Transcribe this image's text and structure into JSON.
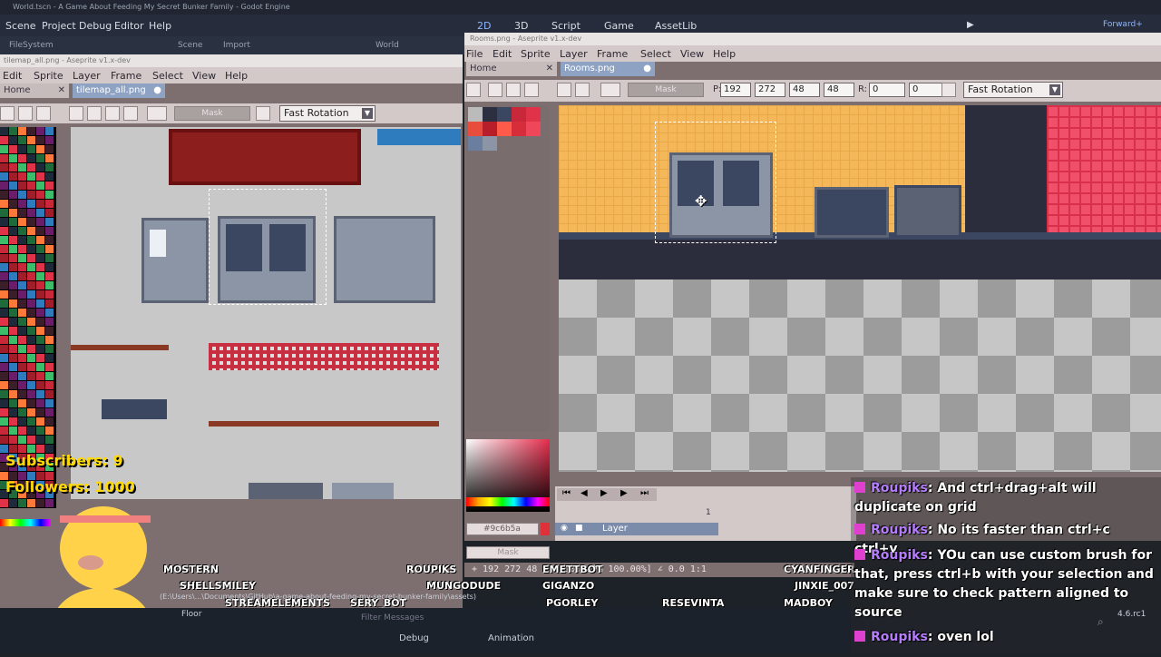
{
  "godot": {
    "window_title": "World.tscn - A Game About Feeding My Secret Bunker Family - Godot Engine",
    "menu": [
      "Scene",
      "Project",
      "Debug",
      "Editor",
      "Help"
    ],
    "workspaces": [
      "2D",
      "3D",
      "Script",
      "Game",
      "AssetLib"
    ],
    "dock_tabs": [
      "FileSystem",
      "Scene",
      "Import"
    ],
    "scene_tab": "World",
    "renderer": "Forward+",
    "bottom_tabs": [
      "Debug",
      "Animation"
    ],
    "filter_placeholder": "Filter Messages",
    "version": "4.6.rc1",
    "floor_label": "Floor",
    "path_text": "(E:\\Users\\...\\Documents\\GitHub\\a-game-about-feeding-my-secret-bunker-family\\assets)"
  },
  "ase_left": {
    "title": "tilemap_all.png - Aseprite v1.x-dev",
    "menu": [
      "Edit",
      "Sprite",
      "Layer",
      "Frame",
      "Select",
      "View",
      "Help"
    ],
    "tabs": [
      "Home",
      "tilemap_all.png"
    ],
    "mask_label": "Mask",
    "rotation": "Fast Rotation",
    "hex": "#9c6b5a"
  },
  "ase_right": {
    "title": "Rooms.png - Aseprite v1.x-dev",
    "menu": [
      "File",
      "Edit",
      "Sprite",
      "Layer",
      "Frame",
      "Select",
      "View",
      "Help"
    ],
    "tabs": [
      "Home",
      "Rooms.png"
    ],
    "mask_label": "Mask",
    "p_label": "P:",
    "x": "192",
    "y": "272",
    "w": "48",
    "h": "48",
    "r_label": "R:",
    "r1": "0",
    "r2": "0",
    "rotation": "Fast Rotation",
    "hex": "#9c6b5a",
    "layer_name": "Layer",
    "frame_number": "1",
    "status": "+ 192 272   48 48 [100.00% 100.00%] ∠ 0.0   1:1"
  },
  "stream": {
    "subscribers": "Subscribers: 9",
    "followers": "Followers: 1000",
    "viewers": [
      "MOSTERN",
      "SHELLSMILEY",
      "STREAMELEMENTS",
      "SERY_BOT",
      "ROUPIKS",
      "MUNGODUDE",
      "GIGANZO",
      "PGORLEY",
      "EMETTBOT",
      "RESEVINTA",
      "CYANFINGER",
      "JINXIE_007",
      "MADBOY"
    ]
  },
  "chat": [
    {
      "user": "Roupiks",
      "text": "And ctrl+drag+alt will duplicate on grid"
    },
    {
      "user": "Roupiks",
      "text": "No its faster than ctrl+c ctrl+v"
    },
    {
      "user": "Roupiks",
      "text": "YOu can use custom brush for that, press ctrl+b with your selection and make sure to check pattern aligned to source"
    },
    {
      "user": "Roupiks",
      "text": "oven lol"
    }
  ],
  "colors": {
    "accent": "#e040d0",
    "godot_bg": "#262c3b",
    "ase_chrome": "#d3c9c9",
    "sticker_yellow": "#ffd900"
  }
}
